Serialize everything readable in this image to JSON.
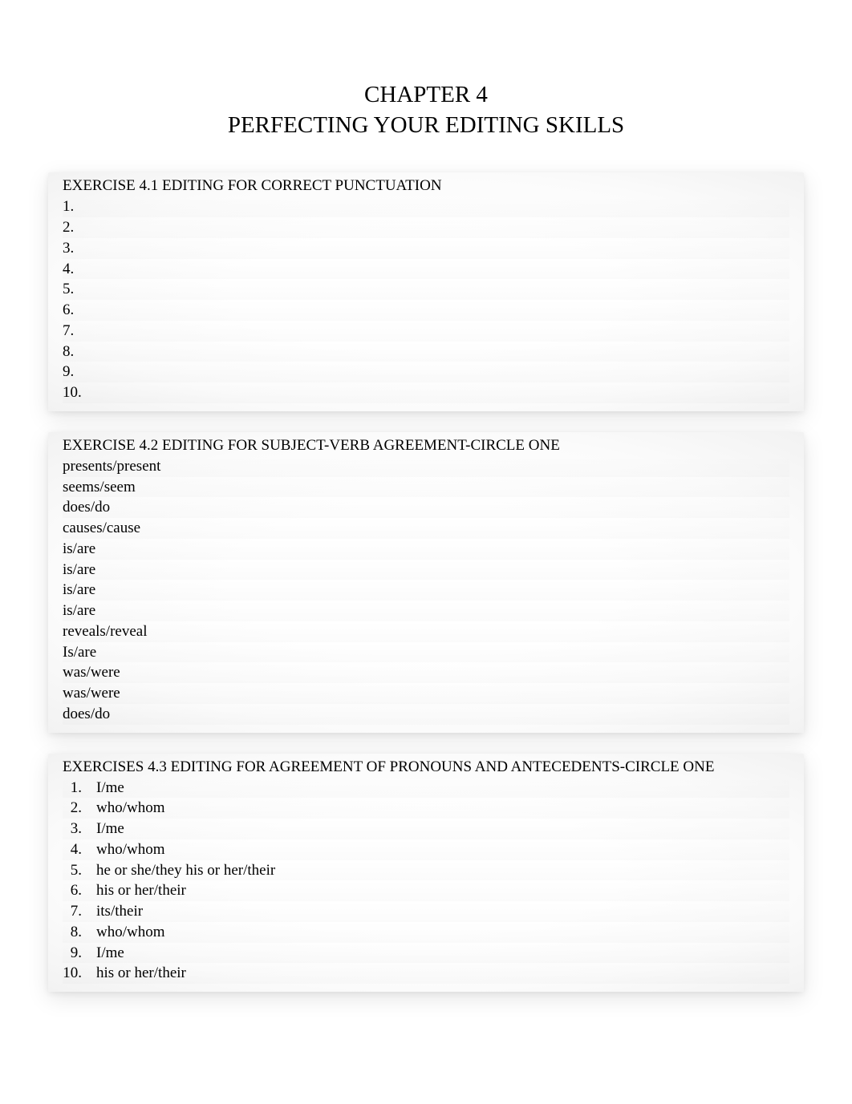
{
  "chapter": {
    "line1": "CHAPTER 4",
    "line2": "PERFECTING YOUR EDITING SKILLS"
  },
  "exercise1": {
    "heading": "EXERCISE 4.1 EDITING FOR CORRECT PUNCTUATION",
    "items": [
      {
        "num": "1.",
        "text": ""
      },
      {
        "num": "2.",
        "text": ""
      },
      {
        "num": "3.",
        "text": ""
      },
      {
        "num": "4.",
        "text": ""
      },
      {
        "num": "5.",
        "text": ""
      },
      {
        "num": "6.",
        "text": ""
      },
      {
        "num": "7.",
        "text": ""
      },
      {
        "num": "8.",
        "text": ""
      },
      {
        "num": "9.",
        "text": ""
      },
      {
        "num": "10.",
        "text": ""
      }
    ]
  },
  "exercise2": {
    "heading": "EXERCISE 4.2 EDITING FOR SUBJECT-VERB AGREEMENT-CIRCLE ONE",
    "items": [
      "presents/present",
      "seems/seem",
      "does/do",
      "causes/cause",
      "is/are",
      "is/are",
      "is/are",
      "is/are",
      "reveals/reveal",
      "Is/are",
      "was/were",
      "was/were",
      "does/do"
    ]
  },
  "exercise3": {
    "heading": "EXERCISES 4.3 EDITING FOR AGREEMENT OF PRONOUNS AND ANTECEDENTS-CIRCLE ONE",
    "items": [
      {
        "num": "1.",
        "text": "I/me"
      },
      {
        "num": "2.",
        "text": "who/whom"
      },
      {
        "num": "3.",
        "text": "I/me"
      },
      {
        "num": "4.",
        "text": "who/whom"
      },
      {
        "num": "5.",
        "text": "he or she/they   his or her/their"
      },
      {
        "num": "6.",
        "text": "his or her/their"
      },
      {
        "num": "7.",
        "text": "its/their"
      },
      {
        "num": "8.",
        "text": "who/whom"
      },
      {
        "num": "9.",
        "text": "I/me"
      },
      {
        "num": "10.",
        "text": "his or her/their"
      }
    ]
  }
}
